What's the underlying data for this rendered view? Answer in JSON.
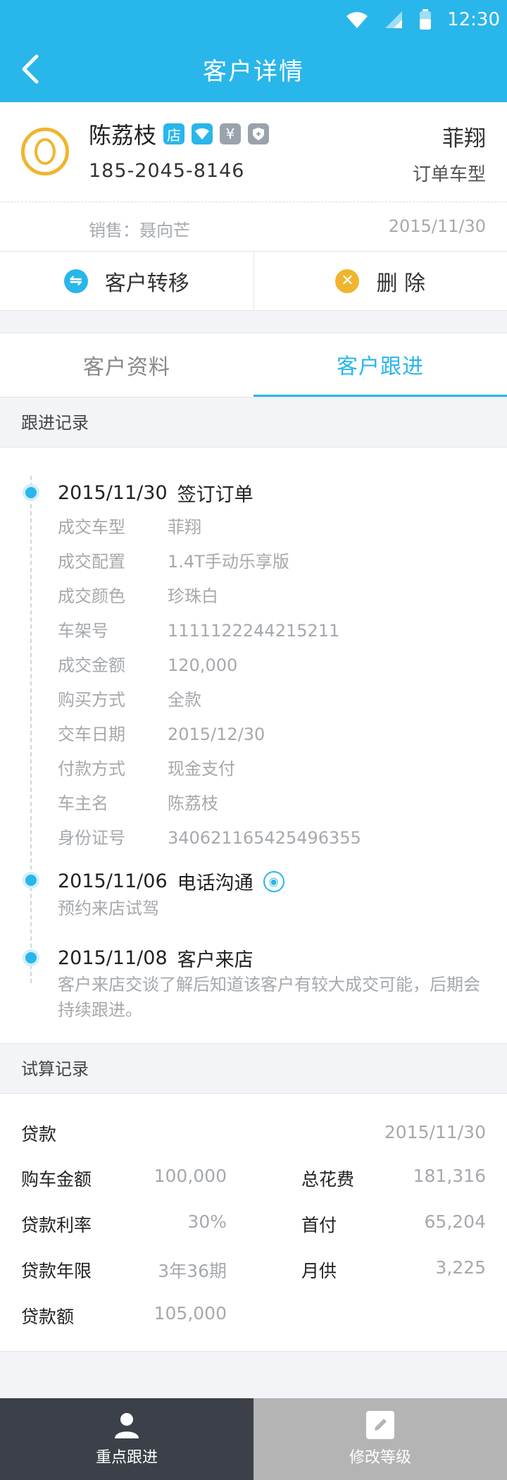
{
  "status": {
    "time": "12:30"
  },
  "nav": {
    "title": "客户详情"
  },
  "customer": {
    "name": "陈荔枝",
    "badges": [
      "店",
      "wifi-badge",
      "¥",
      "shield-badge"
    ],
    "phone": "185-2045-8146",
    "model": "菲翔",
    "order_label": "订单车型",
    "sales": "销售：聂向芒",
    "date": "2015/11/30"
  },
  "actions": {
    "transfer": "客户转移",
    "delete": "删 除"
  },
  "tabs": [
    {
      "label": "客户资料",
      "active": false
    },
    {
      "label": "客户跟进",
      "active": true
    }
  ],
  "followup": {
    "header": "跟进记录",
    "events": [
      {
        "date": "2015/11/30",
        "title": "签订订单",
        "details": [
          {
            "k": "成交车型",
            "v": "菲翔"
          },
          {
            "k": "成交配置",
            "v": "1.4T手动乐享版"
          },
          {
            "k": "成交颜色",
            "v": "珍珠白"
          },
          {
            "k": "车架号",
            "v": "1111122244215211"
          },
          {
            "k": "成交金额",
            "v": "120,000"
          },
          {
            "k": "购买方式",
            "v": "全款"
          },
          {
            "k": "交车日期",
            "v": "2015/12/30"
          },
          {
            "k": "付款方式",
            "v": "现金支付"
          },
          {
            "k": "车主名",
            "v": "陈荔枝"
          },
          {
            "k": "身份证号",
            "v": "340621165425496355"
          }
        ]
      },
      {
        "date": "2015/11/06",
        "title": "电话沟通",
        "note": "预约来店试驾"
      },
      {
        "date": "2015/11/08",
        "title": "客户来店",
        "note": "客户来店交谈了解后知道该客户有较大成交可能，后期会持续跟进。"
      }
    ]
  },
  "loan": {
    "header": "试算记录",
    "title": "贷款",
    "date": "2015/11/30",
    "rows_left": [
      {
        "k": "购车金额",
        "v": "100,000"
      },
      {
        "k": "贷款利率",
        "v": "30%"
      },
      {
        "k": "贷款年限",
        "v": "3年36期"
      },
      {
        "k": "贷款额",
        "v": "105,000"
      }
    ],
    "rows_right": [
      {
        "k": "总花费",
        "v": "181,316"
      },
      {
        "k": "首付",
        "v": "65,204"
      },
      {
        "k": "月供",
        "v": "3,225"
      }
    ]
  },
  "bottom": {
    "left": "重点跟进",
    "right": "修改等级"
  },
  "colors": {
    "primary": "#29b6ea",
    "accent": "#f0b52e",
    "dark": "#3b4049"
  }
}
